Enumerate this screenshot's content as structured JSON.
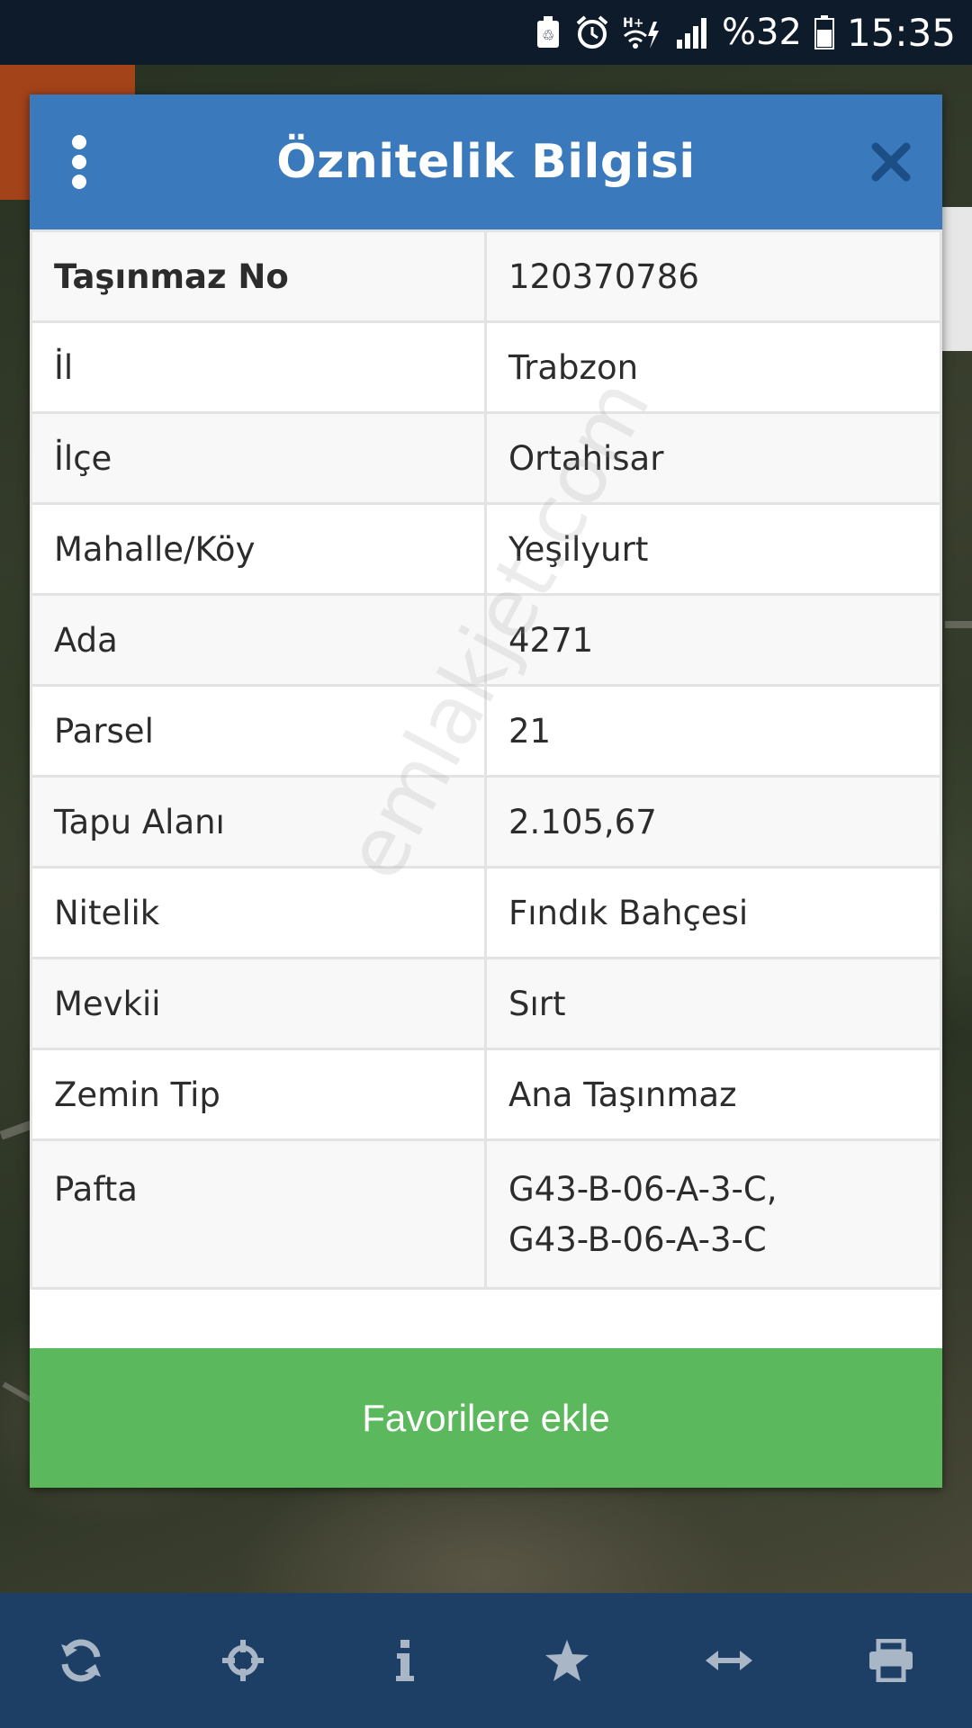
{
  "status_bar": {
    "icons": [
      "recycle-icon",
      "alarm-icon",
      "wifi-hplus-icon",
      "signal-icon",
      "battery-icon"
    ],
    "battery_percent": "%32",
    "time": "15:35"
  },
  "dialog": {
    "title": "Öznitelik Bilgisi",
    "menu_icon": "more-vertical-icon",
    "close_icon": "close-icon",
    "header_color": "#3a79bb",
    "rows": [
      {
        "key": "Taşınmaz No",
        "value": "120370786"
      },
      {
        "key": "İl",
        "value": "Trabzon"
      },
      {
        "key": "İlçe",
        "value": "Ortahisar"
      },
      {
        "key": "Mahalle/Köy",
        "value": "Yeşilyurt"
      },
      {
        "key": "Ada",
        "value": "4271"
      },
      {
        "key": "Parsel",
        "value": "21"
      },
      {
        "key": "Tapu Alanı",
        "value": "2.105,67"
      },
      {
        "key": "Nitelik",
        "value": "Fındık Bahçesi"
      },
      {
        "key": "Mevkii",
        "value": "Sırt"
      },
      {
        "key": "Zemin Tip",
        "value": "Ana Taşınmaz"
      },
      {
        "key": "Pafta",
        "value": "G43-B-06-A-3-C,      G43-B-06-A-3-C"
      }
    ],
    "favorite_button": "Favorilere ekle",
    "favorite_color": "#5cb85c"
  },
  "watermark": "emlakjet.com",
  "toolbar": {
    "color": "#1d3f66",
    "icons": [
      "refresh-icon",
      "crosshair-icon",
      "info-icon",
      "star-icon",
      "measure-icon",
      "print-icon"
    ]
  }
}
